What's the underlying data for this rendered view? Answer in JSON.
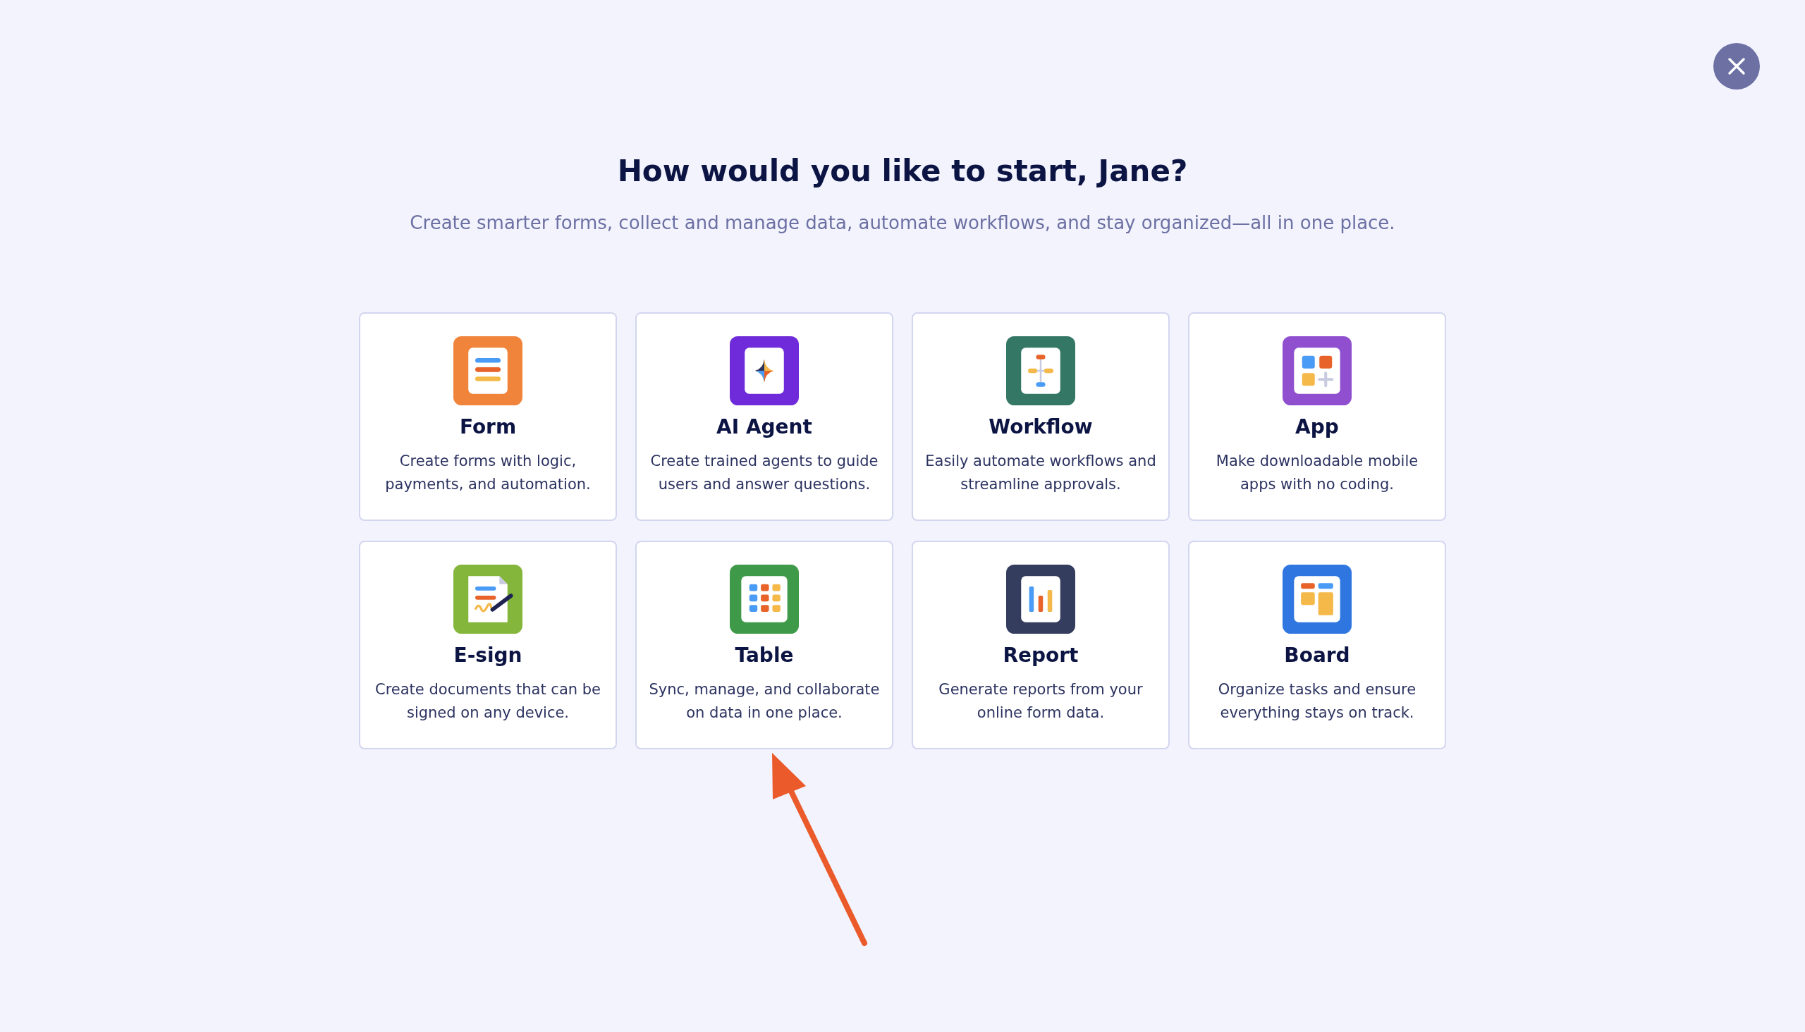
{
  "title": "How would you like to start, Jane?",
  "subtitle": "Create smarter forms, collect and manage data, automate workflows, and stay organized—all in one place.",
  "cards": [
    {
      "kind": "form",
      "color": "#f0843b",
      "name": "Form",
      "description": "Create forms with logic, payments, and automation."
    },
    {
      "kind": "agent",
      "color": "#6f2bd9",
      "name": "AI Agent",
      "description": "Create trained agents to guide users and answer questions."
    },
    {
      "kind": "workflow",
      "color": "#337764",
      "name": "Workflow",
      "description": "Easily automate workflows and streamline approvals."
    },
    {
      "kind": "app",
      "color": "#8f4fcf",
      "name": "App",
      "description": "Make downloadable mobile apps with no coding."
    },
    {
      "kind": "esign",
      "color": "#84b63b",
      "name": "E-sign",
      "description": "Create documents that can be signed on any device."
    },
    {
      "kind": "table",
      "color": "#3e9a48",
      "name": "Table",
      "description": "Sync, manage, and collaborate on data in one place."
    },
    {
      "kind": "report",
      "color": "#343d5e",
      "name": "Report",
      "description": "Generate reports from your online form data."
    },
    {
      "kind": "board",
      "color": "#2f76e0",
      "name": "Board",
      "description": "Organize tasks and ensure everything stays on track."
    }
  ]
}
